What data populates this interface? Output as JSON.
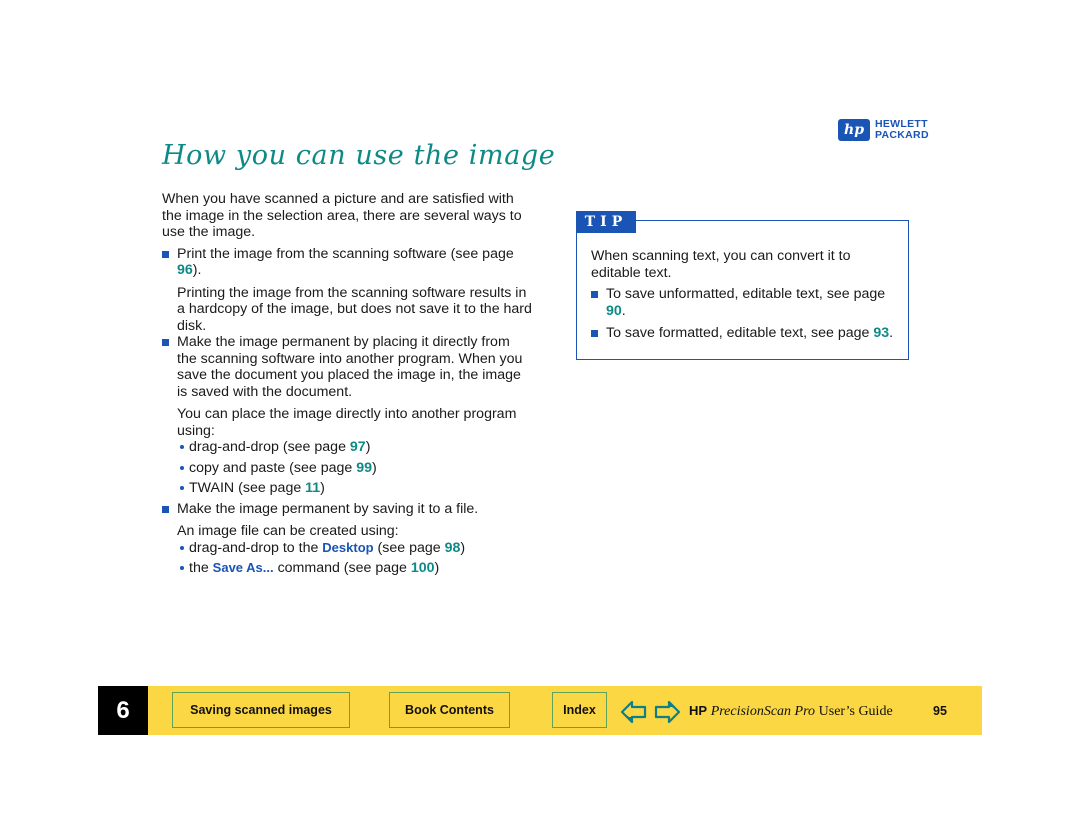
{
  "logo": {
    "badge": "hp",
    "line1": "HEWLETT",
    "line2": "PACKARD",
    "color": "#1a55b5"
  },
  "title": "How you can use the image",
  "intro": "When you have scanned a picture and are satisfied with the image in the selection area, there are several ways to use the image.",
  "items": [
    {
      "text": "Print the image from the scanning software (see page ",
      "page": "96",
      "tail": ")."
    },
    {
      "note": "Printing the image from the scanning software results in a hardcopy of the image, but does not save it to the hard disk."
    },
    {
      "text": "Make the image permanent by placing it directly from the scanning software into another program. When you save the document you placed the image in, the image is saved with the document."
    },
    {
      "note": "You can place the image directly into another program using:"
    },
    {
      "text": "Make the image permanent by saving it to a file."
    },
    {
      "note": "An image file can be created using:"
    }
  ],
  "place_methods": [
    {
      "text": "drag-and-drop (see page ",
      "page": "97",
      "tail": ")"
    },
    {
      "text": "copy and paste (see page ",
      "page": "99",
      "tail": ")"
    },
    {
      "text": "TWAIN (see page ",
      "page": "11",
      "tail": ")"
    }
  ],
  "file_methods": [
    {
      "pre": "drag-and-drop to the ",
      "cmd": "Desktop",
      "text": " (see page ",
      "page": "98",
      "tail": ")"
    },
    {
      "pre": "the ",
      "cmd": "Save As...",
      "text": " command (see page ",
      "page": "100",
      "tail": ")"
    }
  ],
  "tip": {
    "label": "TIP",
    "intro": "When scanning text, you can convert it to editable text.",
    "items": [
      {
        "text": "To save unformatted, editable text, see page ",
        "page": "90",
        "tail": "."
      },
      {
        "text": "To save formatted, editable text, see page ",
        "page": "93",
        "tail": "."
      }
    ]
  },
  "footer": {
    "chapter": "6",
    "buttons": {
      "section": "Saving scanned images",
      "contents": "Book Contents",
      "index": "Index"
    },
    "prev_icon": "arrow-left-icon",
    "next_icon": "arrow-right-icon",
    "guide_hp": "HP",
    "guide_product": "PrecisionScan Pro",
    "guide_suffix": "User’s Guide",
    "page_number": "95",
    "bar_color": "#fbd743"
  }
}
